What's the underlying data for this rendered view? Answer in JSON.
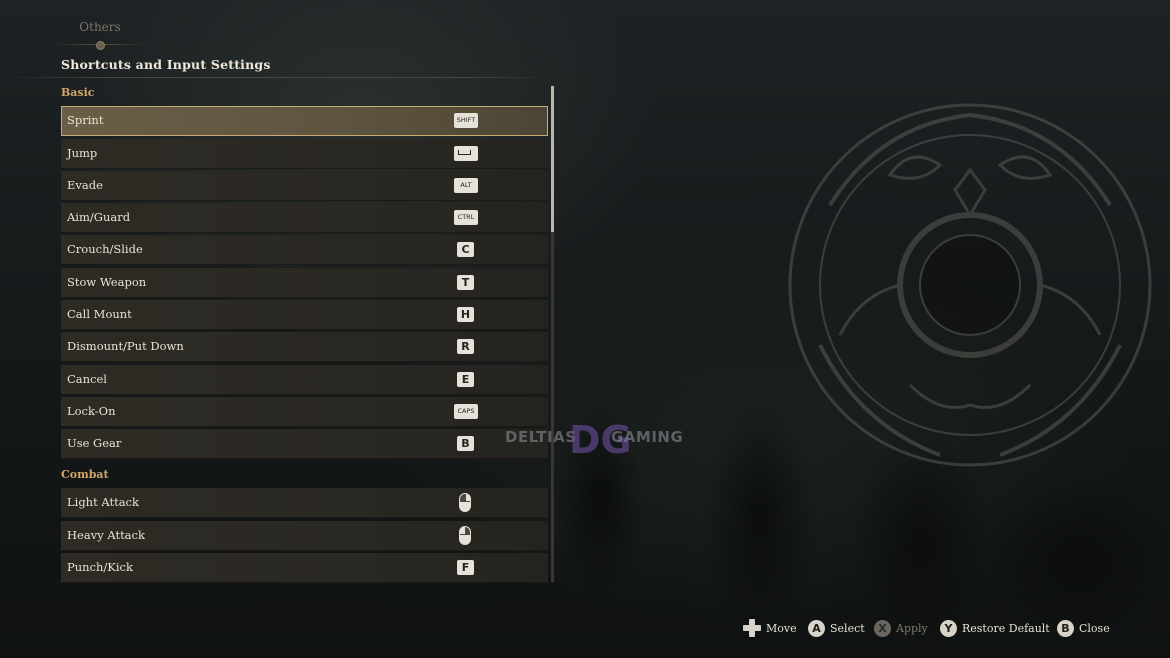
{
  "header": {
    "tab_label": "Others",
    "page_title": "Shortcuts and Input Settings"
  },
  "sections": [
    {
      "title": "Basic",
      "items": [
        {
          "label": "Sprint",
          "key": "SHIFT",
          "selected": true
        },
        {
          "label": "Jump",
          "key": "space-icon"
        },
        {
          "label": "Evade",
          "key": "ALT"
        },
        {
          "label": "Aim/Guard",
          "key": "CTRL"
        },
        {
          "label": "Crouch/Slide",
          "key": "C"
        },
        {
          "label": "Stow Weapon",
          "key": "T"
        },
        {
          "label": "Call Mount",
          "key": "H"
        },
        {
          "label": "Dismount/Put Down",
          "key": "R"
        },
        {
          "label": "Cancel",
          "key": "E"
        },
        {
          "label": "Lock-On",
          "key": "CAPS"
        },
        {
          "label": "Use Gear",
          "key": "B"
        }
      ]
    },
    {
      "title": "Combat",
      "items": [
        {
          "label": "Light Attack",
          "key": "mouse-left-icon"
        },
        {
          "label": "Heavy Attack",
          "key": "mouse-right-icon"
        },
        {
          "label": "Punch/Kick",
          "key": "F"
        }
      ]
    }
  ],
  "watermark": {
    "left": "DELTIAS",
    "logo": "DG",
    "right": "GAMING"
  },
  "footer_hints": [
    {
      "icon": "dpad-icon",
      "label": "Move"
    },
    {
      "icon": "A",
      "label": "Select"
    },
    {
      "icon": "X",
      "label": "Apply",
      "disabled": true
    },
    {
      "icon": "Y",
      "label": "Restore Default"
    },
    {
      "icon": "B",
      "label": "Close"
    }
  ],
  "colors": {
    "accent": "#d2a769",
    "selected_border": "#c7ac72",
    "row_bg": "#2b2924",
    "background": "#15191b"
  }
}
